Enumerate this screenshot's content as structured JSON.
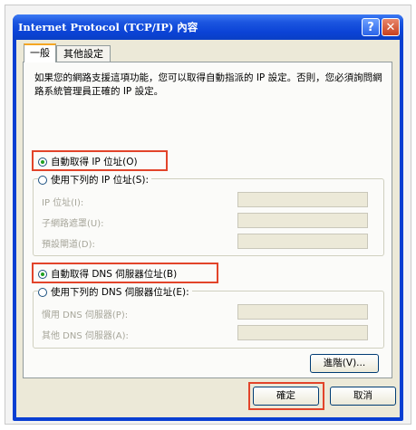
{
  "window": {
    "title": "Internet Protocol (TCP/IP) 內容",
    "help_label": "?",
    "close_label": "✕"
  },
  "tabs": [
    {
      "label": "一般",
      "active": true
    },
    {
      "label": "其他設定",
      "active": false
    }
  ],
  "description": "如果您的網路支援這項功能，您可以取得自動指派的 IP 設定。否則，您必須詢問網路系統管理員正確的 IP 設定。",
  "ip": {
    "auto_label": "自動取得 IP 位址(O)",
    "manual_label": "使用下列的 IP 位址(S):",
    "selected": "auto",
    "fields": [
      {
        "label": "IP 位址(I):",
        "value": ""
      },
      {
        "label": "子網路遮罩(U):",
        "value": ""
      },
      {
        "label": "預設閘道(D):",
        "value": ""
      }
    ]
  },
  "dns": {
    "auto_label": "自動取得 DNS 伺服器位址(B)",
    "manual_label": "使用下列的 DNS 伺服器位址(E):",
    "selected": "auto",
    "fields": [
      {
        "label": "慣用 DNS 伺服器(P):",
        "value": ""
      },
      {
        "label": "其他 DNS 伺服器(A):",
        "value": ""
      }
    ]
  },
  "buttons": {
    "advanced": "進階(V)...",
    "ok": "確定",
    "cancel": "取消"
  },
  "colors": {
    "highlight_box": "#e2442a",
    "titlebar": "#0b43d6",
    "dialog_bg": "#ece9d8"
  }
}
